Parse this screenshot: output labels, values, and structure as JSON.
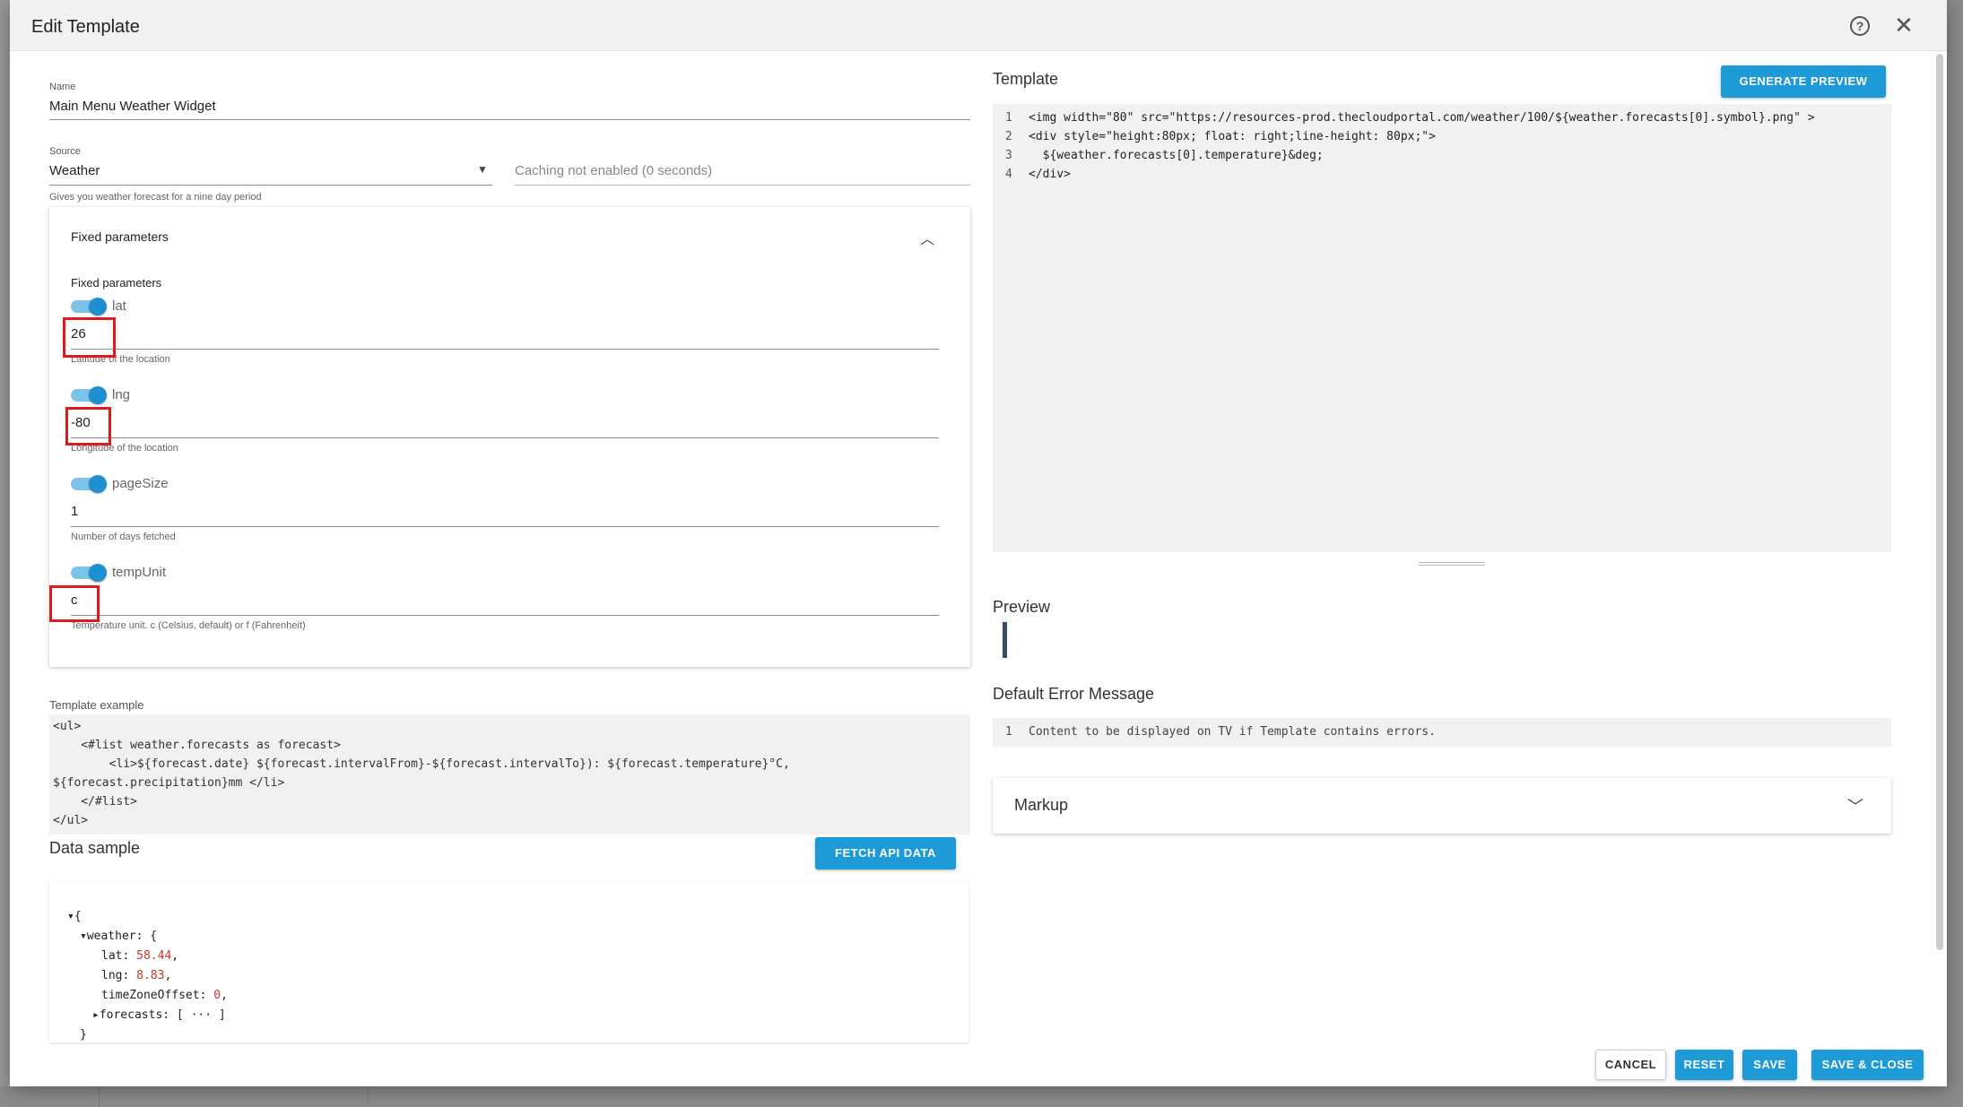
{
  "dialog": {
    "title": "Edit Template",
    "help_icon": "question-circle-icon",
    "close_icon": "close-icon"
  },
  "name_field": {
    "label": "Name",
    "value": "Main Menu Weather Widget"
  },
  "source_field": {
    "label": "Source",
    "value": "Weather",
    "helper": "Gives you weather forecast for a nine day period"
  },
  "caching": {
    "placeholder": "Caching not enabled (0 seconds)"
  },
  "fixed_params": {
    "header": "Fixed parameters",
    "subheader": "Fixed parameters",
    "items": [
      {
        "name": "lat",
        "value": "26",
        "helper": "Latitude of the location",
        "enabled": true
      },
      {
        "name": "lng",
        "value": "-80",
        "helper": "Longitude of the location",
        "enabled": true
      },
      {
        "name": "pageSize",
        "value": "1",
        "helper": "Number of days fetched",
        "enabled": true
      },
      {
        "name": "tempUnit",
        "value": "c",
        "helper": "Temperature unit. c (Celsius, default) or f (Fahrenheit)",
        "enabled": true
      }
    ]
  },
  "template_example": {
    "label": "Template example",
    "lines": [
      "<ul>",
      "    <#list weather.forecasts as forecast>",
      "        <li>${forecast.date} ${forecast.intervalFrom}-${forecast.intervalTo}): ${forecast.temperature}°C,",
      "${forecast.precipitation}mm </li>",
      "    </#list>",
      "</ul>"
    ]
  },
  "data_sample": {
    "label": "Data sample",
    "fetch_button": "FETCH API DATA",
    "lines": [
      {
        "indent": 0,
        "toggle": "▾",
        "text": "{"
      },
      {
        "indent": 1,
        "toggle": "▾",
        "key": "weather",
        "text": ": {"
      },
      {
        "indent": 2,
        "key": "lat",
        "value": "58.44"
      },
      {
        "indent": 2,
        "key": "lng",
        "value": "8.83"
      },
      {
        "indent": 2,
        "key": "timeZoneOffset",
        "value": "0"
      },
      {
        "indent": 2,
        "toggle": "▸",
        "key": "forecasts",
        "text": ": [ ··· ]"
      },
      {
        "indent": 1,
        "text": "}"
      }
    ]
  },
  "template_editor": {
    "label": "Template",
    "generate_button": "GENERATE PREVIEW",
    "line_numbers": [
      "1",
      "2",
      "3",
      "4"
    ],
    "lines": [
      "<img width=\"80\" src=\"https://resources-prod.thecloudportal.com/weather/100/${weather.forecasts[0].symbol}.png\" >",
      "<div style=\"height:80px; float: right;line-height: 80px;\">",
      "  ${weather.forecasts[0].temperature}&deg;",
      "</div>"
    ]
  },
  "preview": {
    "label": "Preview"
  },
  "default_error": {
    "label": "Default Error Message",
    "line_number": "1",
    "text": "Content to be displayed on TV if Template contains errors."
  },
  "markup": {
    "label": "Markup"
  },
  "footer": {
    "cancel": "CANCEL",
    "reset": "RESET",
    "save": "SAVE",
    "save_close": "SAVE & CLOSE"
  },
  "colors": {
    "primary": "#1e9ad6",
    "toggle_on": "#1e8fd1",
    "highlight_box": "#e0191a"
  }
}
